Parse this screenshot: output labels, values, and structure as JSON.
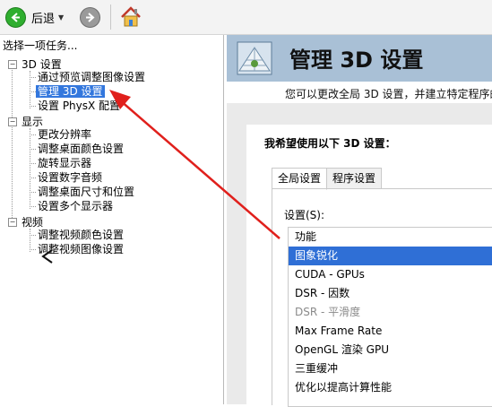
{
  "toolbar": {
    "back_label": "后退"
  },
  "left_pane": {
    "task_header": "选择一项任务...",
    "groups": [
      {
        "label": "3D 设置",
        "items": [
          "通过预览调整图像设置",
          "管理 3D 设置",
          "设置 PhysX 配置"
        ]
      },
      {
        "label": "显示",
        "items": [
          "更改分辨率",
          "调整桌面颜色设置",
          "旋转显示器",
          "设置数字音频",
          "调整桌面尺寸和位置",
          "设置多个显示器"
        ]
      },
      {
        "label": "视频",
        "items": [
          "调整视频颜色设置",
          "调整视频图像设置"
        ]
      }
    ]
  },
  "main": {
    "title": "管理 3D 设置",
    "subtitle": "您可以更改全局 3D 设置，并建立特定程序的",
    "section_heading": "我希望使用以下 3D 设置：",
    "tabs": [
      "全局设置",
      "程序设置"
    ],
    "settings_label": "设置(S):",
    "list_items": [
      "功能",
      "图象锐化",
      "CUDA - GPUs",
      "DSR - 因数",
      "DSR - 平滑度",
      "Max Frame Rate",
      "OpenGL 渲染 GPU",
      "三重缓冲",
      "优化以提高计算性能"
    ]
  },
  "colors": {
    "selection": "#2f6fd6",
    "header_band": "#a9c0d6",
    "annotation_arrow": "#e0201c"
  }
}
